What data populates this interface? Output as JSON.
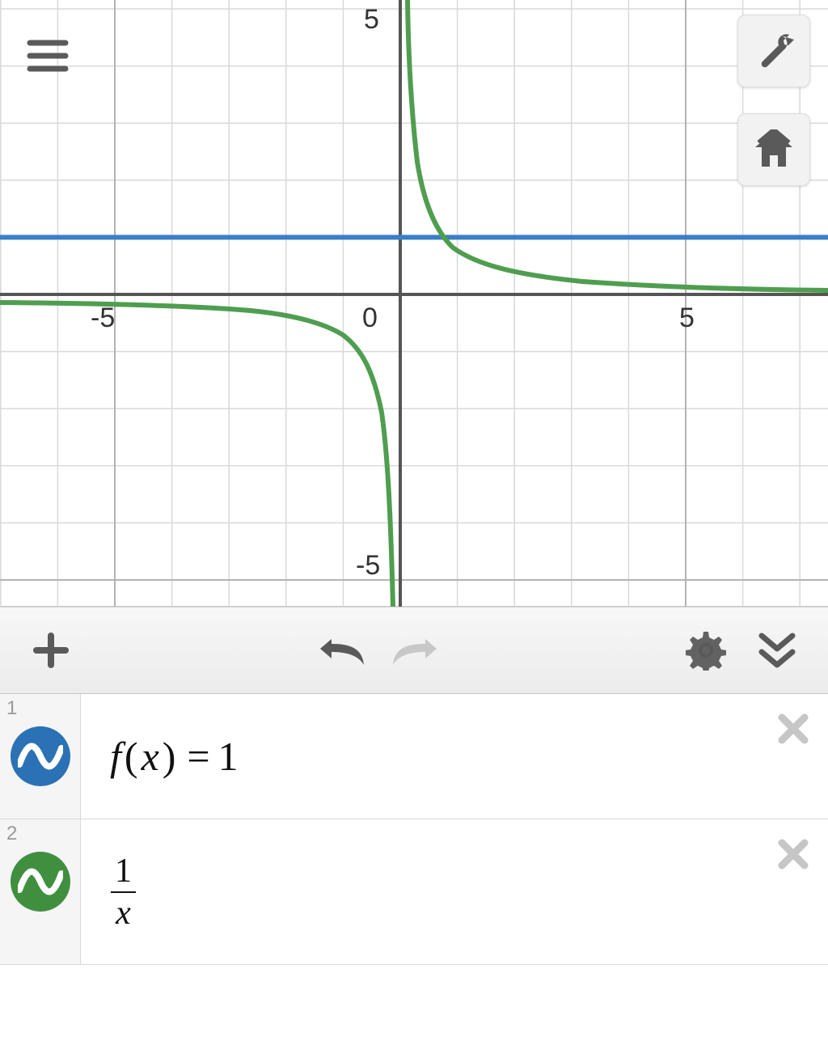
{
  "chart_data": {
    "type": "line",
    "title": "",
    "xlabel": "",
    "ylabel": "",
    "xlim": [
      -7,
      7.5
    ],
    "ylim": [
      -5.5,
      5.5
    ],
    "x_ticks": [
      -5,
      0,
      5
    ],
    "y_ticks": [
      -5,
      5
    ],
    "grid": true,
    "series": [
      {
        "name": "f(x) = 1",
        "color": "#3b7fc4",
        "type": "hline",
        "y": 1
      },
      {
        "name": "1/x",
        "color": "#4f9e4f",
        "type": "reciprocal",
        "sample_points": [
          {
            "x": -5,
            "y": -0.2
          },
          {
            "x": -2,
            "y": -0.5
          },
          {
            "x": -1,
            "y": -1
          },
          {
            "x": -0.5,
            "y": -2
          },
          {
            "x": -0.2,
            "y": -5
          },
          {
            "x": 0.2,
            "y": 5
          },
          {
            "x": 0.5,
            "y": 2
          },
          {
            "x": 1,
            "y": 1
          },
          {
            "x": 2,
            "y": 0.5
          },
          {
            "x": 5,
            "y": 0.2
          }
        ]
      }
    ]
  },
  "graph": {
    "axis_labels": {
      "x_neg": "-5",
      "x_zero": "0",
      "x_pos": "5",
      "y_pos": "5",
      "y_neg": "-5"
    }
  },
  "toolbar": {
    "add": "+",
    "undo": "undo",
    "redo": "redo",
    "settings": "settings",
    "collapse": "collapse"
  },
  "expressions": [
    {
      "index": "1",
      "color": "#2a72b5",
      "type": "text",
      "display": {
        "fn": "f",
        "arg": "x",
        "eq": "=",
        "rhs": "1"
      }
    },
    {
      "index": "2",
      "color": "#3f8f3f",
      "type": "fraction",
      "display": {
        "num": "1",
        "den": "x"
      }
    }
  ]
}
